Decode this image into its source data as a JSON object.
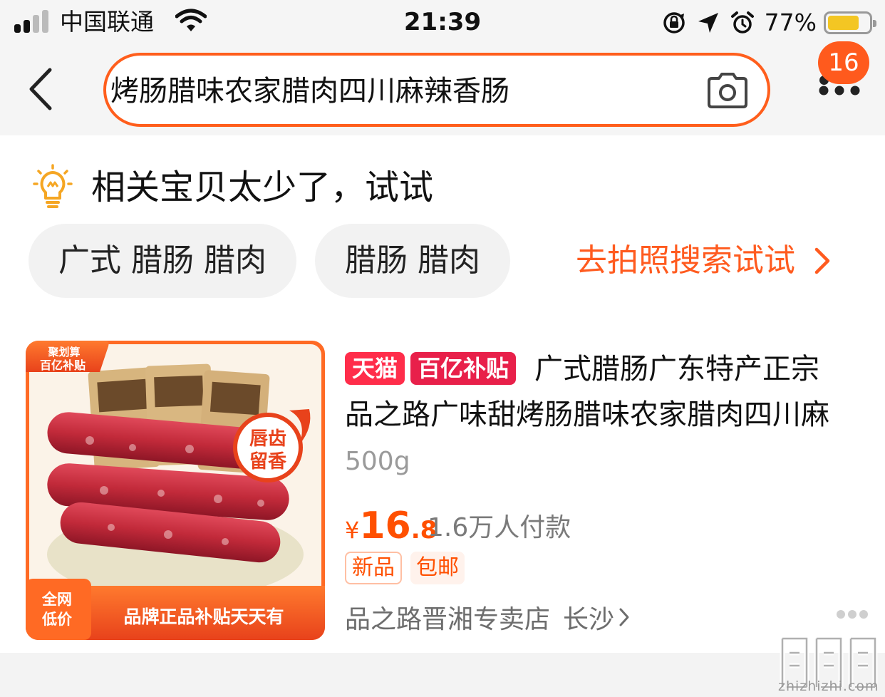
{
  "status_bar": {
    "carrier": "中国联通",
    "time": "21:39",
    "battery_percent": "77%",
    "battery_level": 0.77,
    "icons": [
      "signal-icon",
      "wifi-icon",
      "orientation-lock-icon",
      "location-icon",
      "alarm-icon",
      "battery-icon"
    ]
  },
  "header": {
    "search_query": "烤肠腊味农家腊肉四川麻辣香肠",
    "back_icon": "chevron-left-icon",
    "camera_icon": "camera-icon",
    "more_icon": "more-dots-icon",
    "badge_count": "16"
  },
  "suggestion": {
    "tip_icon": "lightbulb-icon",
    "tip_text": "相关宝贝太少了，试试",
    "chips": [
      "广式 腊肠 腊肉",
      "腊肠 腊肉"
    ],
    "photo_search_label": "去拍照搜索试试"
  },
  "product": {
    "image_badges": {
      "top_line1": "聚划算",
      "top_line2": "百亿补贴",
      "seal_line1": "唇齿",
      "seal_line2": "留香",
      "bottom_left_line1": "全网",
      "bottom_left_line2": "低价",
      "bottom_banner": "品牌正品补贴天天有"
    },
    "tags": [
      "天猫",
      "百亿补贴"
    ],
    "title_line1": "广式腊肠广东特产正宗",
    "title_line2": "品之路广味甜烤肠腊味农家腊肉四川麻",
    "spec": "500g",
    "price_symbol": "¥",
    "price_integer": "16",
    "price_decimal": ".8",
    "sales": "1.6万人付款",
    "labels": [
      "新品",
      "包邮"
    ],
    "shop_name": "品之路晋湘专卖店",
    "shop_city": "长沙"
  },
  "watermark": {
    "logo_text": "值值值",
    "site": "zhizhizhi.com"
  },
  "colors": {
    "accent": "#ff5000",
    "search_border": "#ff5e1c",
    "badge_bg": "#ff5a1d",
    "tmall_red": "#ff2d4a",
    "chip_bg": "#f2f2f2"
  }
}
